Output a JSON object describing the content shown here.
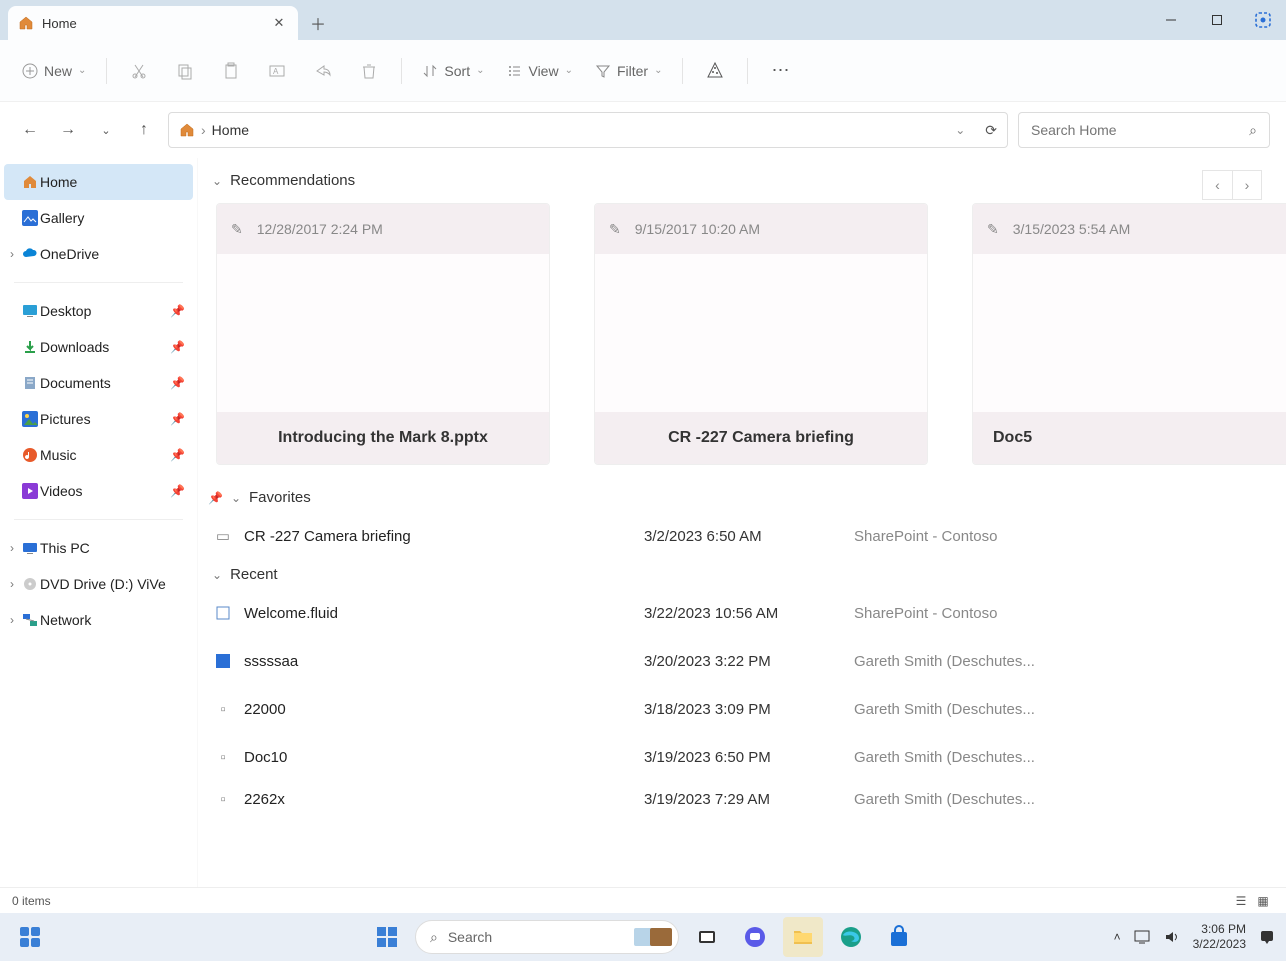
{
  "tab": {
    "title": "Home"
  },
  "toolbar": {
    "new_label": "New",
    "sort_label": "Sort",
    "view_label": "View",
    "filter_label": "Filter"
  },
  "addressbar": {
    "location": "Home"
  },
  "search": {
    "placeholder": "Search Home"
  },
  "sidebar": {
    "items": [
      {
        "label": "Home"
      },
      {
        "label": "Gallery"
      },
      {
        "label": "OneDrive"
      },
      {
        "label": "Desktop"
      },
      {
        "label": "Downloads"
      },
      {
        "label": "Documents"
      },
      {
        "label": "Pictures"
      },
      {
        "label": "Music"
      },
      {
        "label": "Videos"
      },
      {
        "label": "This PC"
      },
      {
        "label": "DVD Drive (D:) ViVe"
      },
      {
        "label": "Network"
      }
    ]
  },
  "sections": {
    "recommendations": "Recommendations",
    "favorites": "Favorites",
    "recent": "Recent"
  },
  "recommendations": [
    {
      "date": "12/28/2017 2:24 PM",
      "title": "Introducing the Mark 8.pptx"
    },
    {
      "date": "9/15/2017 10:20 AM",
      "title": "CR -227 Camera briefing"
    },
    {
      "date": "3/15/2023 5:54 AM",
      "title": "Doc5"
    }
  ],
  "favorites": [
    {
      "name": "CR -227 Camera briefing",
      "date": "3/2/2023 6:50 AM",
      "location": "SharePoint - Contoso"
    }
  ],
  "recent": [
    {
      "name": "Welcome.fluid",
      "date": "3/22/2023 10:56 AM",
      "location": "SharePoint - Contoso"
    },
    {
      "name": "sssssaa",
      "date": "3/20/2023 3:22 PM",
      "location": "Gareth Smith (Deschutes..."
    },
    {
      "name": "22000",
      "date": "3/18/2023 3:09 PM",
      "location": "Gareth Smith (Deschutes..."
    },
    {
      "name": "Doc10",
      "date": "3/19/2023 6:50 PM",
      "location": "Gareth Smith (Deschutes..."
    },
    {
      "name": "2262x",
      "date": "3/19/2023 7:29 AM",
      "location": "Gareth Smith (Deschutes..."
    }
  ],
  "status": {
    "items": "0 items"
  },
  "taskbar": {
    "search_placeholder": "Search",
    "time": "3:06 PM",
    "date": "3/22/2023"
  }
}
